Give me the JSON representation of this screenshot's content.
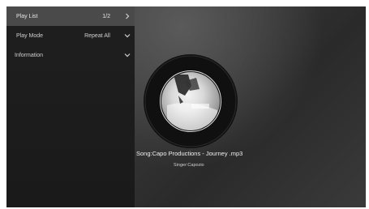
{
  "sidebar": {
    "items": [
      {
        "label": "Play List",
        "value": "1/2",
        "icon": "chevron-right-icon"
      },
      {
        "label": "Play Mode",
        "value": "Repeat All",
        "icon": "chevron-down-icon"
      },
      {
        "label": "Information",
        "value": "",
        "icon": "chevron-down-icon"
      }
    ]
  },
  "now_playing": {
    "song": "Song:Capo Productions - Journey .mp3",
    "singer": "Singer:Capozio"
  },
  "colors": {
    "panel": "#1f1f1f",
    "selected": "#4a4a4a",
    "text": "#cfcfcf",
    "disc_ring": "#111111"
  }
}
